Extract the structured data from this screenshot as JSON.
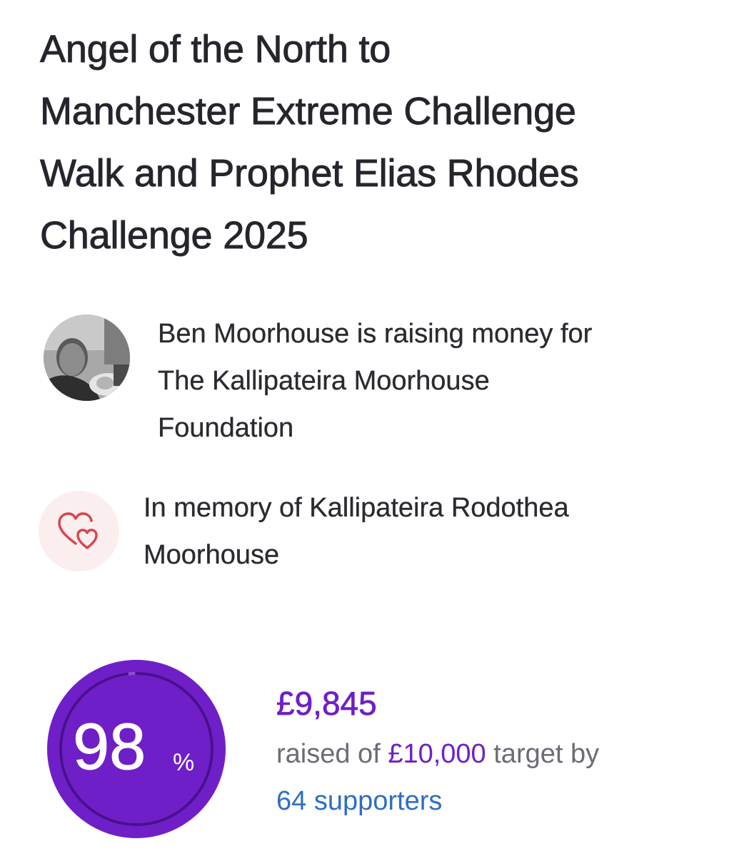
{
  "page": {
    "title_lines": [
      "Angel of the North to",
      "Manchester Extreme Challenge",
      "Walk and Prophet Elias Rhodes",
      "Challenge 2025"
    ]
  },
  "fundraiser": {
    "avatar_icon": "fundraiser-photo",
    "text_lines": [
      "Ben Moorhouse is raising money for",
      "The Kallipateira Moorhouse",
      "Foundation"
    ]
  },
  "memory": {
    "icon": "hearts-icon",
    "icon_color": "#d9444f",
    "icon_bg": "#fbeeee",
    "text_lines": [
      "In memory of Kallipateira Rodothea",
      "Moorhouse"
    ]
  },
  "progress": {
    "percent_value": "98",
    "percent_sign": "%",
    "fraction": 0.98,
    "ring_color": "#6f1fc7",
    "amount_raised": "£9,845",
    "raised_prefix": "raised of",
    "target": "£10,000",
    "raised_suffix": "target by",
    "supporters": "64 supporters"
  }
}
